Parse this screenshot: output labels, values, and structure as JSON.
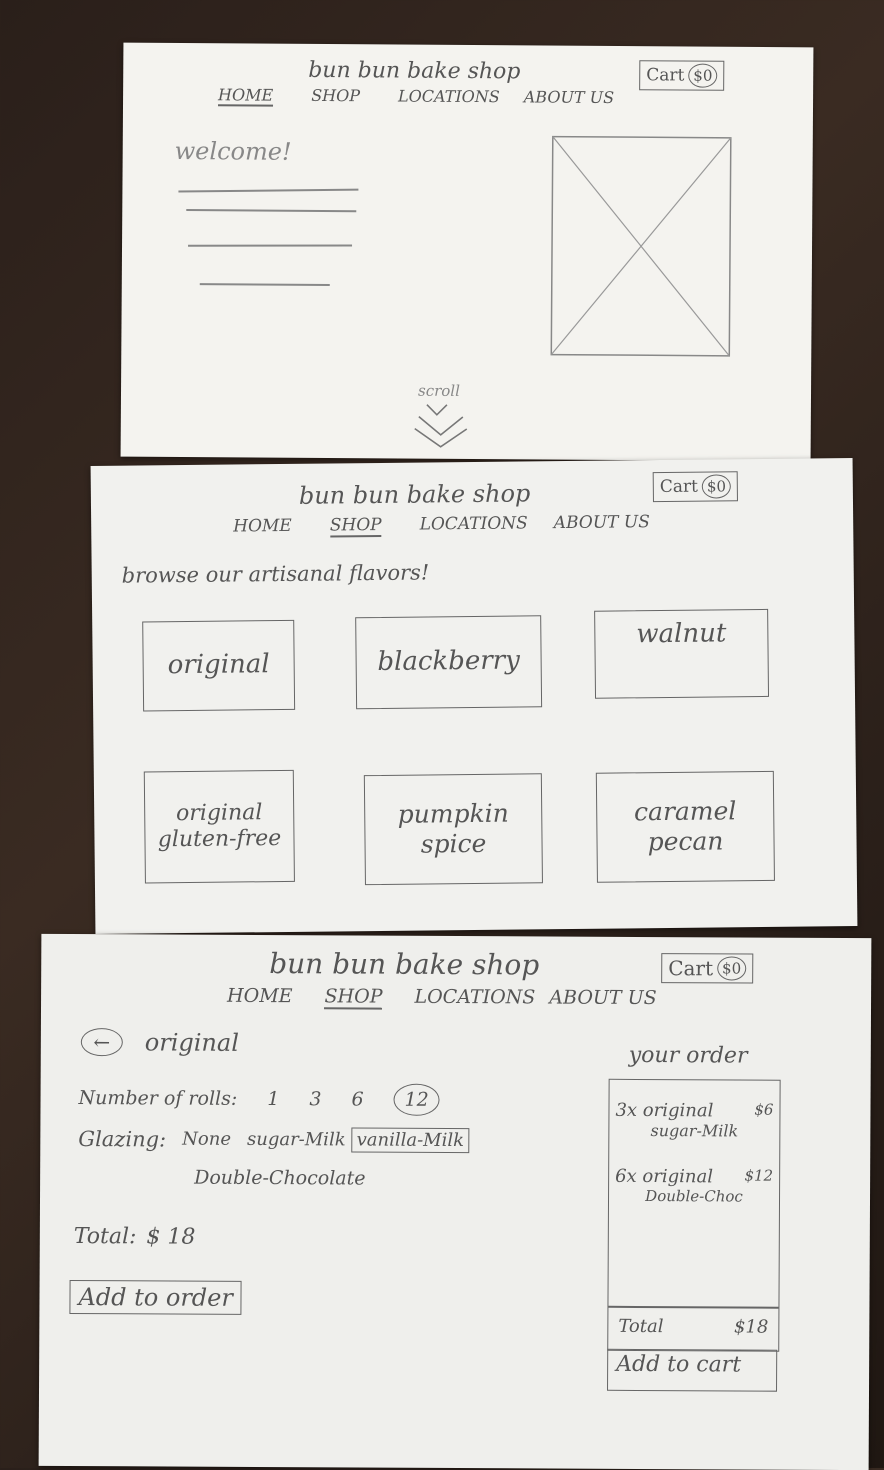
{
  "brand": "bun bun bake shop",
  "nav": {
    "home": "HOME",
    "shop": "SHOP",
    "locations": "LOCATIONS",
    "about": "ABOUT US"
  },
  "cart": {
    "label": "Cart",
    "amount": "$0"
  },
  "page1": {
    "welcome": "welcome!",
    "scroll": "scroll"
  },
  "page2": {
    "heading": "browse our artisanal flavors!",
    "flavors": [
      "original",
      "blackberry",
      "walnut",
      "original gluten-free",
      "pumpkin spice",
      "caramel pecan"
    ]
  },
  "page3": {
    "back_title": "original",
    "rolls_label": "Number of rolls:",
    "rolls_options": [
      "1",
      "3",
      "6",
      "12"
    ],
    "glazing_label": "Glazing:",
    "glazing_options": [
      "None",
      "sugar-Milk",
      "vanilla-Milk",
      "Double-Chocolate"
    ],
    "total_label": "Total:",
    "total_value": "$ 18",
    "add_to_order": "Add to order",
    "your_order": "your order",
    "order_items": [
      {
        "line": "3x original",
        "price": "$6",
        "glaze": "sugar-Milk"
      },
      {
        "line": "6x original",
        "price": "$12",
        "glaze": "Double-Choc"
      }
    ],
    "order_total_label": "Total",
    "order_total_value": "$18",
    "add_to_cart": "Add to cart"
  }
}
